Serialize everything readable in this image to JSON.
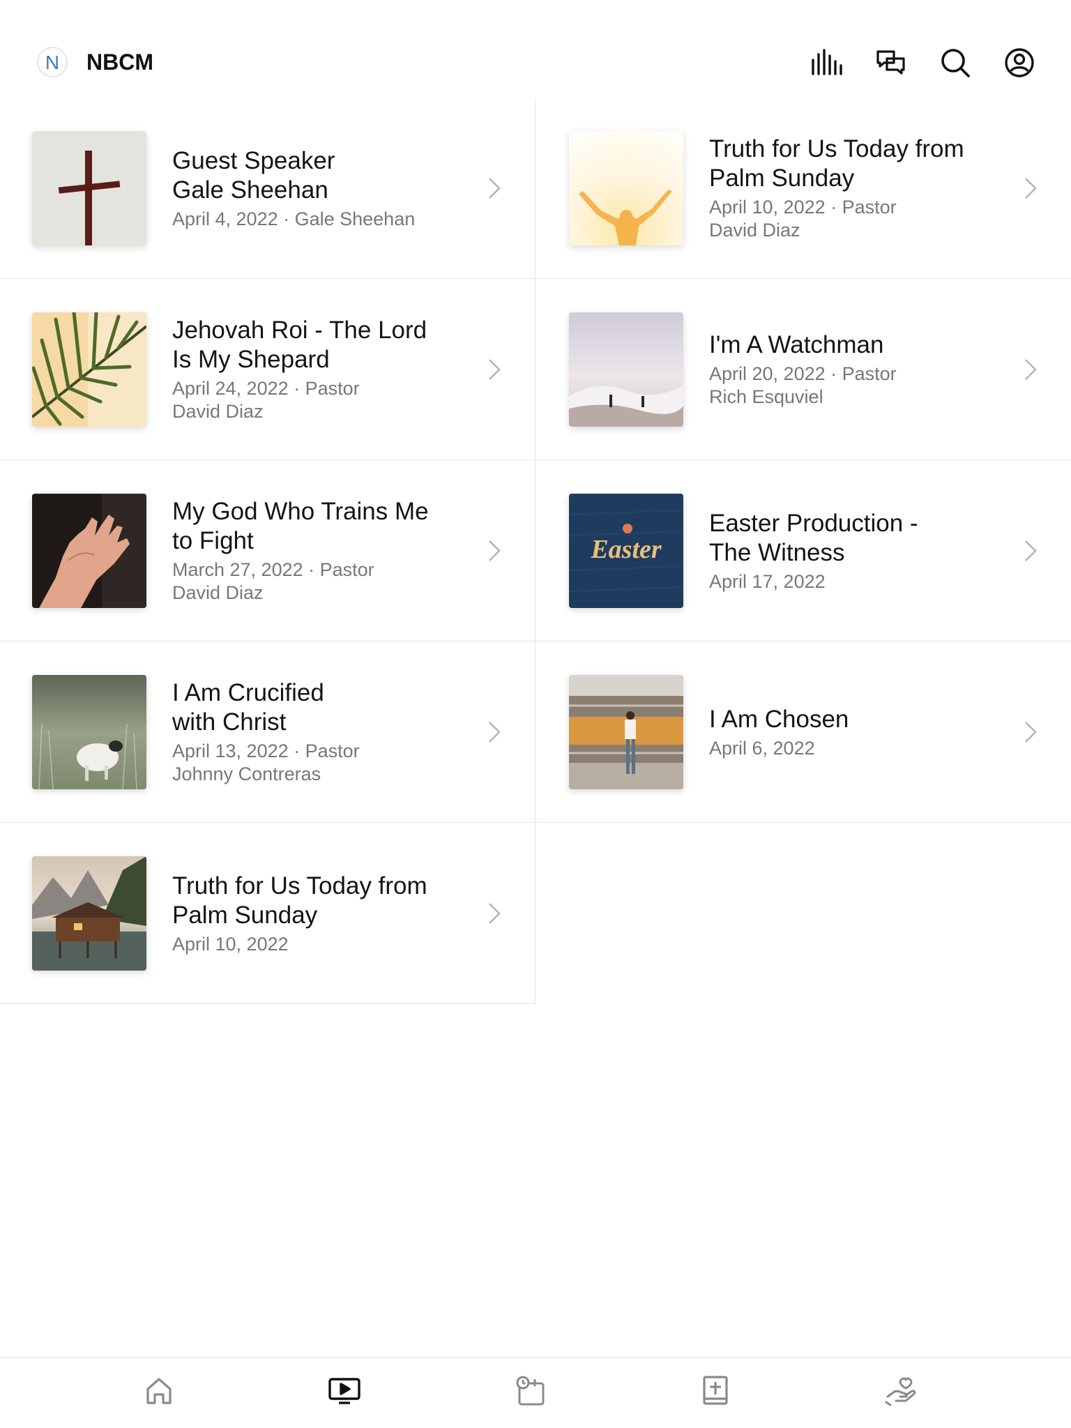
{
  "header": {
    "app_title": "NBCM",
    "logo_letter": "N",
    "actions": [
      {
        "name": "audio-bars-icon"
      },
      {
        "name": "chat-icon"
      },
      {
        "name": "search-icon"
      },
      {
        "name": "account-icon"
      }
    ]
  },
  "sermons": [
    {
      "title_line1": "Guest Speaker",
      "title_line2": "Gale Sheehan",
      "meta_line1": "April 4, 2022 · Gale Sheehan",
      "meta_line2": "",
      "thumb": "cross"
    },
    {
      "title_line1": "Truth for Us Today from",
      "title_line2": "Palm Sunday",
      "meta_line1": "April 10, 2022 · Pastor",
      "meta_line2": "David Diaz",
      "thumb": "sunrise-arms"
    },
    {
      "title_line1": "Jehovah Roi - The Lord",
      "title_line2": "Is My Shepard",
      "meta_line1": "April 24, 2022 · Pastor",
      "meta_line2": "David Diaz",
      "thumb": "palm-leaf"
    },
    {
      "title_line1": "I'm A Watchman",
      "title_line2": "",
      "meta_line1": "April 20, 2022 · Pastor",
      "meta_line2": "Rich Esquviel",
      "thumb": "beach-waves"
    },
    {
      "title_line1": "My God Who Trains Me",
      "title_line2": "to Fight",
      "meta_line1": "March 27, 2022 · Pastor",
      "meta_line2": "David Diaz",
      "thumb": "open-hand"
    },
    {
      "title_line1": "Easter Production -",
      "title_line2": "The Witness",
      "meta_line1": "April 17, 2022",
      "meta_line2": "",
      "thumb": "easter",
      "thumb_text": "Easter"
    },
    {
      "title_line1": "I Am Crucified",
      "title_line2": "with Christ",
      "meta_line1": "April 13, 2022 · Pastor",
      "meta_line2": "Johnny Contreras",
      "thumb": "lamb"
    },
    {
      "title_line1": "I Am Chosen",
      "title_line2": "",
      "meta_line1": "April 6, 2022",
      "meta_line2": "",
      "thumb": "train"
    },
    {
      "title_line1": "Truth for Us Today from",
      "title_line2": "Palm Sunday",
      "meta_line1": "April 10, 2022",
      "meta_line2": "",
      "thumb": "lake-cabin"
    }
  ],
  "tabbar": {
    "tabs": [
      {
        "name": "home-icon",
        "active": false
      },
      {
        "name": "media-icon",
        "active": true
      },
      {
        "name": "events-icon",
        "active": false
      },
      {
        "name": "bible-icon",
        "active": false
      },
      {
        "name": "give-icon",
        "active": false
      }
    ]
  },
  "colors": {
    "accent_active": "#111111",
    "icon_inactive": "#8a8a8a",
    "divider": "#e6e6e6",
    "meta_text": "#777777",
    "logo_blue": "#3a7fb8"
  }
}
